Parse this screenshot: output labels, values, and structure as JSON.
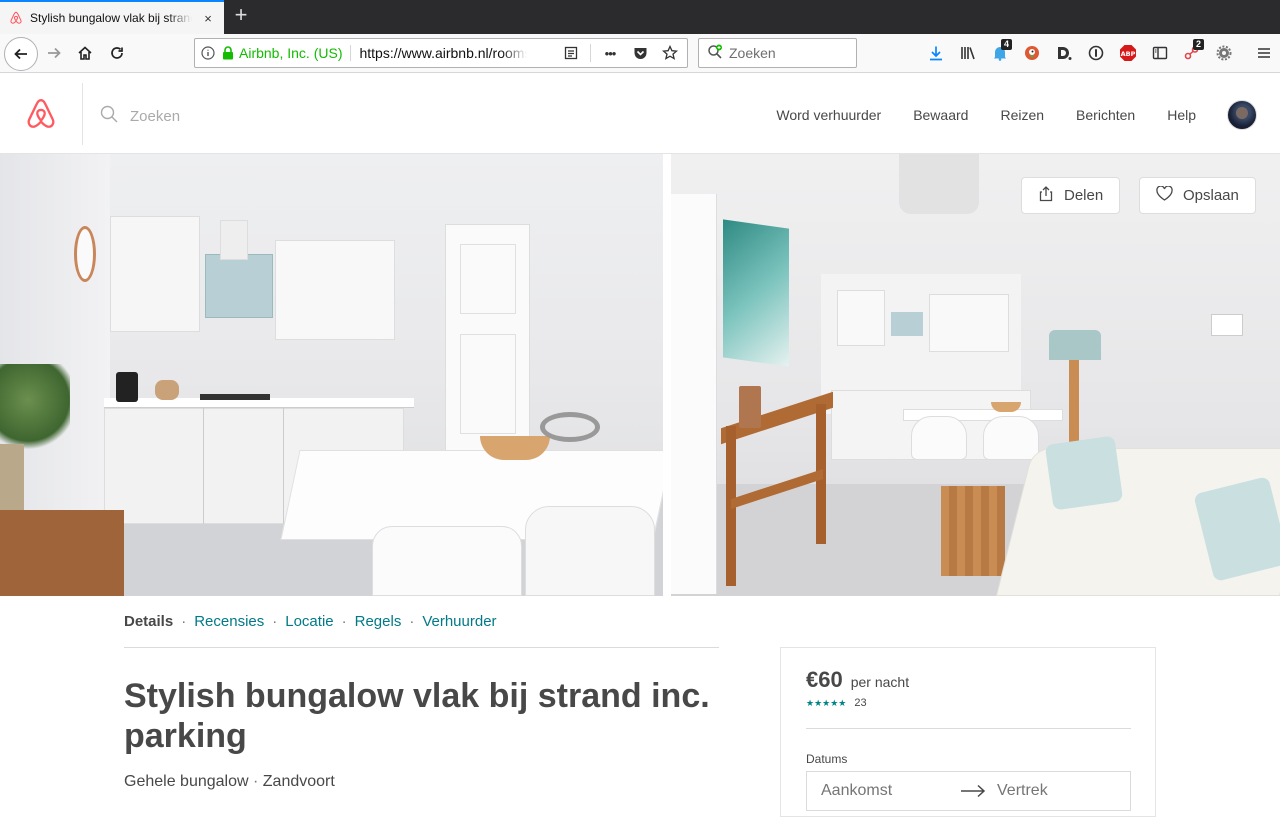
{
  "browser": {
    "tab_title": "Stylish bungalow vlak bij strand inc. parking",
    "tab_close": "×",
    "new_tab": "+",
    "identity": "Airbnb, Inc. (US)",
    "url": "https://www.airbnb.nl/rooms/",
    "url_more": "•••",
    "search_placeholder": "Zoeken",
    "badges": {
      "notifications": "4",
      "extension": "2"
    }
  },
  "header": {
    "search_placeholder": "Zoeken",
    "nav": [
      "Word verhuurder",
      "Bewaard",
      "Reizen",
      "Berichten",
      "Help"
    ]
  },
  "photos": {
    "share_label": "Delen",
    "save_label": "Opslaan"
  },
  "subnav": [
    "Details",
    "Recensies",
    "Locatie",
    "Regels",
    "Verhuurder"
  ],
  "subnav_separator": "·",
  "listing": {
    "title": "Stylish bungalow vlak bij strand inc. parking",
    "type": "Gehele bungalow",
    "separator": " · ",
    "location": "Zandvoort"
  },
  "booking": {
    "price": "€60",
    "per_night": "per nacht",
    "stars": "★★★★★",
    "review_count": "23",
    "dates_label": "Datums",
    "checkin_placeholder": "Aankomst",
    "checkout_placeholder": "Vertrek"
  },
  "colors": {
    "brand": "#FF5A5F",
    "teal": "#007A87",
    "firefox_blue": "#0A84FF",
    "secure_green": "#12BC00"
  }
}
